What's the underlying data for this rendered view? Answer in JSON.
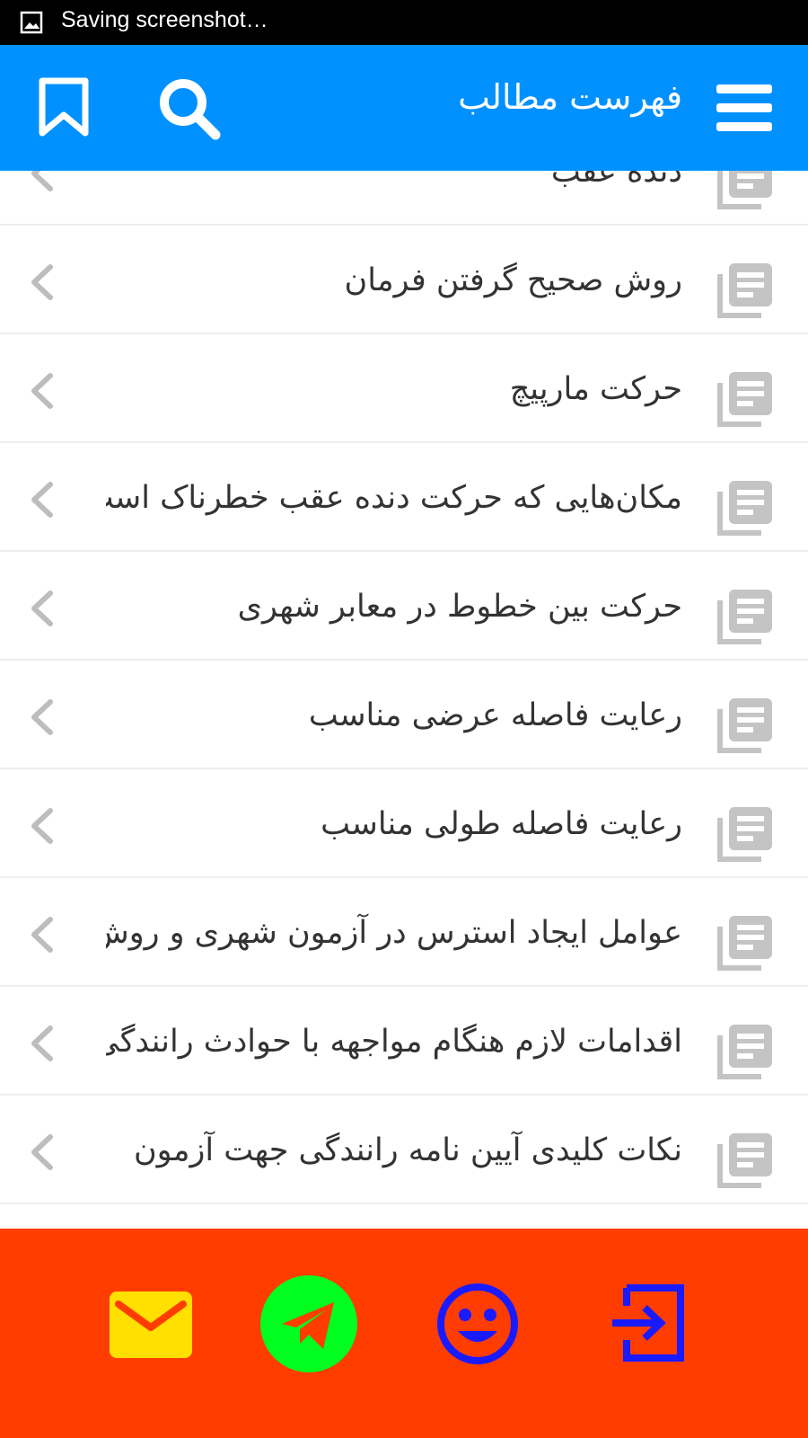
{
  "status_bar": {
    "text": "Saving screenshot…",
    "icon": "image-icon"
  },
  "app_bar": {
    "title": "فهرست مطالب",
    "menu_icon": "menu-icon",
    "search_icon": "search-icon",
    "bookmark_icon": "bookmark-icon",
    "color": "#0091ff"
  },
  "list": {
    "item_icon": "document-icon",
    "chevron_icon": "chevron-left-icon",
    "items": [
      {
        "label": "دنده عقب"
      },
      {
        "label": "روش صحیح گرفتن فرمان"
      },
      {
        "label": "حرکت مارپیچ"
      },
      {
        "label": "مکان‌هایی که  حرکت دنده عقب خطرناک است"
      },
      {
        "label": "حرکت بین خطوط در معابر شهری"
      },
      {
        "label": "رعایت فاصله عرضی مناسب"
      },
      {
        "label": "رعایت فاصله طولی مناسب"
      },
      {
        "label": "عوامل ایجاد استرس در آزمون شهری و روش مقابله"
      },
      {
        "label": "اقدامات لازم هنگام مواجهه با حوادث رانندگی"
      },
      {
        "label": "نکات کلیدی آیین نامه رانندگی جهت آزمون"
      }
    ]
  },
  "bottom_bar": {
    "color": "#ff3d00",
    "buttons": [
      {
        "icon": "mail-icon",
        "color": "#ffe000"
      },
      {
        "icon": "telegram-icon",
        "color": "#00ff1e"
      },
      {
        "icon": "smiley-icon",
        "color": "#1a1aff"
      },
      {
        "icon": "login-icon",
        "color": "#1a1aff"
      }
    ]
  }
}
